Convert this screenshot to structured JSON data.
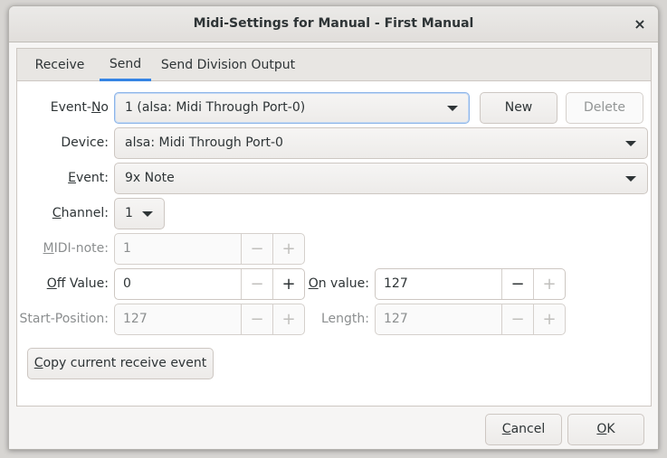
{
  "window": {
    "title": "Midi-Settings for Manual - First Manual",
    "close": "×"
  },
  "tabs": [
    "Receive",
    "Send",
    "Send Division Output"
  ],
  "event_no": {
    "label_a": "Event-",
    "label_u": "N",
    "label_b": "o",
    "value": "1 (alsa: Midi Through Port-0)",
    "new_label": "New",
    "delete_label": "Delete"
  },
  "device": {
    "label": "Device:",
    "value": "alsa: Midi Through Port-0"
  },
  "event": {
    "label_u": "E",
    "label_b": "vent:",
    "value": "9x Note"
  },
  "channel": {
    "label_u": "C",
    "label_b": "hannel:",
    "value": "1"
  },
  "midi_note": {
    "label_u": "M",
    "label_b": "IDI-note:",
    "value": "1"
  },
  "off_value": {
    "label_u": "O",
    "label_b": "ff Value:",
    "value": "0"
  },
  "on_value": {
    "label_u": "O",
    "label_b": "n value:",
    "value": "127"
  },
  "start_position": {
    "label": "Start-Position:",
    "value": "127"
  },
  "length": {
    "label": "Length:",
    "value": "127"
  },
  "copy_button": {
    "label_u": "C",
    "label_b": "opy current receive event"
  },
  "footer": {
    "cancel_u": "C",
    "cancel_b": "ancel",
    "ok_u": "O",
    "ok_b": "K"
  },
  "glyphs": {
    "minus": "−",
    "plus": "+"
  }
}
